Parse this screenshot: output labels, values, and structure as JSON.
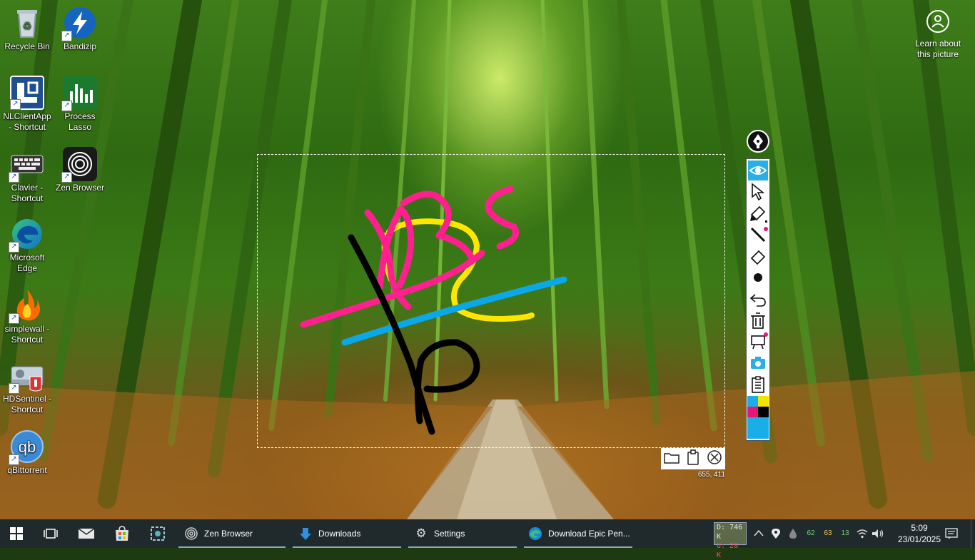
{
  "desktop": {
    "icons": [
      {
        "label": "Recycle Bin"
      },
      {
        "label": "Bandizip"
      },
      {
        "label": "NLClientApp - Shortcut"
      },
      {
        "label": "Process Lasso"
      },
      {
        "label": "Clavier - Shortcut"
      },
      {
        "label": "Zen Browser"
      },
      {
        "label": "Microsoft Edge"
      },
      {
        "label": "simplewall - Shortcut"
      },
      {
        "label": "HDSentinel - Shortcut"
      },
      {
        "label": "qBittorrent"
      }
    ],
    "learn_label": "Learn about this picture"
  },
  "capture": {
    "coordinates": "655, 411",
    "toolbar_icons": [
      "folder-icon",
      "clipboard-icon",
      "close-circle-icon"
    ]
  },
  "epic_pen": {
    "tools": [
      "eye-icon",
      "cursor-icon",
      "highlighter-icon",
      "pen-icon",
      "eraser-icon",
      "dot-icon",
      "undo-icon",
      "trash-icon",
      "whiteboard-icon",
      "camera-icon",
      "clipboard-icon"
    ],
    "active_tool": "eye-icon",
    "palette": [
      "#1aaee8",
      "#f5e400",
      "#e8167a",
      "#000000"
    ],
    "ink_colors": {
      "pink": "#ff1f8e",
      "yellow": "#ffe600",
      "blue": "#0aa8e8",
      "black": "#000000"
    }
  },
  "taskbar": {
    "apps": [
      {
        "label": "Zen Browser"
      },
      {
        "label": "Downloads"
      },
      {
        "label": "Settings"
      },
      {
        "label": "Download Epic Pen..."
      }
    ],
    "net_down": "D: 746 K",
    "net_up": "U: 28 K",
    "tray_values": [
      "62",
      "63",
      "13"
    ],
    "time": "5:09",
    "date": "23/01/2025"
  }
}
